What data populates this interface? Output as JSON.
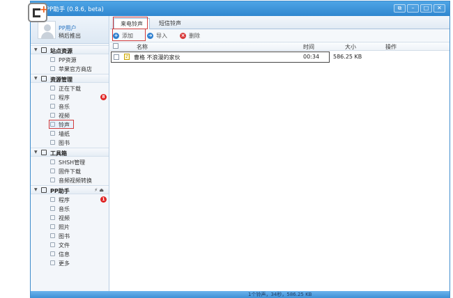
{
  "window": {
    "title": "PP助手 (0.8.6, beta)",
    "buttons": [
      "⧉",
      "–",
      "□",
      "✕"
    ]
  },
  "user": {
    "name": "PP用户",
    "logout": "稍后推出"
  },
  "sidebar": {
    "sections": [
      {
        "label": "站点资源",
        "icon": "home-icon",
        "items": [
          {
            "label": "PP资源",
            "icon": "pp-resource-icon"
          },
          {
            "label": "苹果官方商店",
            "icon": "app-store-icon"
          }
        ]
      },
      {
        "label": "资源管理",
        "icon": "folder-icon",
        "items": [
          {
            "label": "正在下载",
            "icon": "download-icon"
          },
          {
            "label": "程序",
            "icon": "app-icon",
            "badge": "8"
          },
          {
            "label": "音乐",
            "icon": "music-icon"
          },
          {
            "label": "视频",
            "icon": "video-icon"
          },
          {
            "label": "铃声",
            "icon": "bell-icon",
            "selected": true
          },
          {
            "label": "墙纸",
            "icon": "wallpaper-icon"
          },
          {
            "label": "图书",
            "icon": "book-icon"
          }
        ]
      },
      {
        "label": "工具箱",
        "icon": "toolbox-icon",
        "items": [
          {
            "label": "SHSH管理",
            "icon": "shsh-icon"
          },
          {
            "label": "固件下载",
            "icon": "firmware-icon"
          },
          {
            "label": "音频视频转换",
            "icon": "convert-icon"
          }
        ]
      },
      {
        "label": "PP助手",
        "icon": "phone-icon",
        "extra": "⚡ ⏏",
        "items": [
          {
            "label": "程序",
            "icon": "app-icon",
            "badge": "1"
          },
          {
            "label": "音乐",
            "icon": "music-icon"
          },
          {
            "label": "视频",
            "icon": "video-icon"
          },
          {
            "label": "照片",
            "icon": "photo-icon"
          },
          {
            "label": "图书",
            "icon": "book-icon"
          },
          {
            "label": "文件",
            "icon": "file-icon"
          },
          {
            "label": "信息",
            "icon": "message-icon"
          },
          {
            "label": "更多",
            "icon": "more-icon"
          }
        ]
      }
    ]
  },
  "tabs": [
    {
      "label": "来电铃声",
      "active": true
    },
    {
      "label": "短信铃声",
      "active": false
    }
  ],
  "toolbar": {
    "add": "添加",
    "import": "导入",
    "delete": "删除",
    "colors": {
      "add": "#2f80d0",
      "import": "#2f80d0",
      "delete": "#d83b3b"
    }
  },
  "table": {
    "headers": {
      "name": "名称",
      "time": "时间",
      "size": "大小",
      "action": "操作"
    },
    "rows": [
      {
        "name": "曹格 不浪漫的家伙",
        "time": "00:34",
        "size": "586.25 KB"
      }
    ]
  },
  "status": {
    "text": "1个铃声，34秒，586.25 KB"
  }
}
